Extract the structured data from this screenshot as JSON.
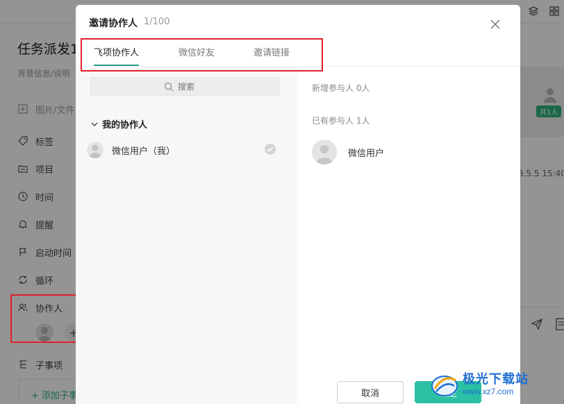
{
  "background": {
    "task_title": "任务派发1",
    "task_desc": "背景信息/说明",
    "attach_label": "图片/文件",
    "rows": {
      "tag": "标签",
      "project": "项目",
      "time": "时间",
      "reminder": "提醒",
      "start_time": "启动时间",
      "repeat": "循环",
      "collaborators": "协作人",
      "subtasks": "子事项"
    },
    "add_subtask": "+ 添加子事",
    "collab_plus": "+",
    "right_badge": "共1人",
    "right_date": "3.5.5 15:40"
  },
  "modal": {
    "title": "邀请协作人",
    "count": "1/100",
    "tabs": [
      {
        "label": "飞项协作人",
        "active": true
      },
      {
        "label": "微信好友",
        "active": false
      },
      {
        "label": "邀请链接",
        "active": false
      }
    ],
    "search_placeholder": "搜索",
    "group_title": "我的协作人",
    "members": [
      {
        "name": "微信用户（我）",
        "selected": true
      }
    ],
    "new_participants_label": "新增参与人 0人",
    "existing_participants_label": "已有参与人 1人",
    "existing_participants": [
      {
        "name": "微信用户"
      }
    ],
    "cancel_label": "取消",
    "ok_label": "确定"
  },
  "watermark": {
    "brand": "极光下载站",
    "url": "www.xz7.com"
  },
  "colors": {
    "accent": "#2bc0a4",
    "tab_underline": "#2a9d8f",
    "highlight_red": "#e0202c",
    "badge_green": "#2db37b",
    "watermark_blue": "#1f6fd1"
  }
}
